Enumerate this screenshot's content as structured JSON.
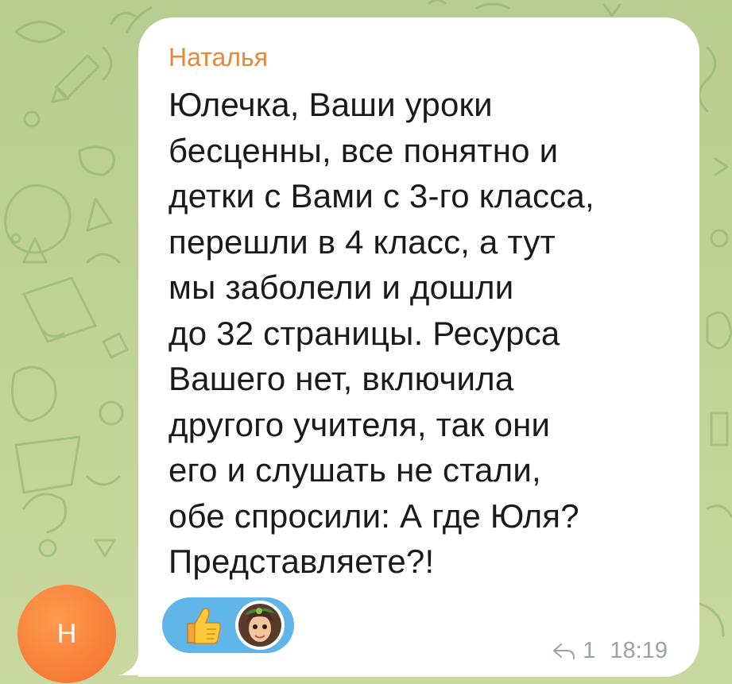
{
  "message": {
    "sender_name": "Наталья",
    "text_lines": [
      "Юлечка, Ваши уроки",
      "бесценны, все понятно и",
      "детки с Вами с 3-го класса,",
      "перешли в 4 класс, а тут",
      "мы заболели и дошли",
      "до 32 страницы. Ресурса",
      "Вашего нет, включила",
      "другого учителя, так они",
      "его и слушать не стали,",
      "обе спросили: А где Юля?",
      "Представляете?!"
    ],
    "reply_count": "1",
    "time": "18:19"
  },
  "avatar": {
    "initial": "Н",
    "color": "#f7803a"
  },
  "reactions": [
    {
      "icon": "thumbs-up-icon"
    },
    {
      "icon": "reactor-avatar"
    }
  ],
  "colors": {
    "sender": "#e5883a",
    "reaction_pill": "#5fb4e8",
    "chat_background": "#bfd294",
    "meta_text": "#9aa59e"
  }
}
